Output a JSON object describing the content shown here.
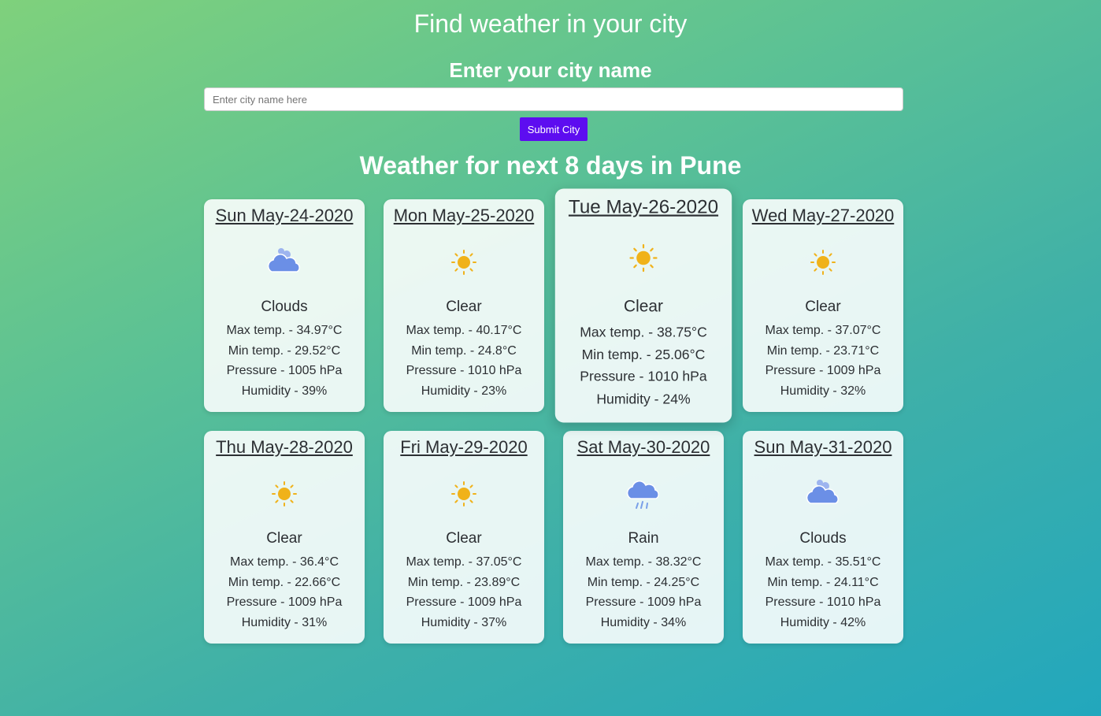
{
  "header": {
    "title": "Find weather in your city",
    "city_label": "Enter your city name",
    "input_placeholder": "Enter city name here",
    "input_value": "",
    "submit_label": "Submit City"
  },
  "forecast": {
    "title": "Weather for next 8 days in Pune",
    "days": [
      {
        "date": "Sun May-24-2020",
        "icon": "clouds-icon",
        "desc": "Clouds",
        "max": "Max temp. - 34.97°C",
        "min": "Min temp. - 29.52°C",
        "pressure": "Pressure - 1005 hPa",
        "humidity": "Humidity - 39%"
      },
      {
        "date": "Mon May-25-2020",
        "icon": "sun-icon",
        "desc": "Clear",
        "max": "Max temp. - 40.17°C",
        "min": "Min temp. - 24.8°C",
        "pressure": "Pressure - 1010 hPa",
        "humidity": "Humidity - 23%"
      },
      {
        "date": "Tue May-26-2020",
        "icon": "sun-icon",
        "desc": "Clear",
        "max": "Max temp. - 38.75°C",
        "min": "Min temp. - 25.06°C",
        "pressure": "Pressure - 1010 hPa",
        "humidity": "Humidity - 24%"
      },
      {
        "date": "Wed May-27-2020",
        "icon": "sun-icon",
        "desc": "Clear",
        "max": "Max temp. - 37.07°C",
        "min": "Min temp. - 23.71°C",
        "pressure": "Pressure - 1009 hPa",
        "humidity": "Humidity - 32%"
      },
      {
        "date": "Thu May-28-2020",
        "icon": "sun-icon",
        "desc": "Clear",
        "max": "Max temp. - 36.4°C",
        "min": "Min temp. - 22.66°C",
        "pressure": "Pressure - 1009 hPa",
        "humidity": "Humidity - 31%"
      },
      {
        "date": "Fri May-29-2020",
        "icon": "sun-icon",
        "desc": "Clear",
        "max": "Max temp. - 37.05°C",
        "min": "Min temp. - 23.89°C",
        "pressure": "Pressure - 1009 hPa",
        "humidity": "Humidity - 37%"
      },
      {
        "date": "Sat May-30-2020",
        "icon": "rain-icon",
        "desc": "Rain",
        "max": "Max temp. - 38.32°C",
        "min": "Min temp. - 24.25°C",
        "pressure": "Pressure - 1009 hPa",
        "humidity": "Humidity - 34%"
      },
      {
        "date": "Sun May-31-2020",
        "icon": "clouds-icon",
        "desc": "Clouds",
        "max": "Max temp. - 35.51°C",
        "min": "Min temp. - 24.11°C",
        "pressure": "Pressure - 1010 hPa",
        "humidity": "Humidity - 42%"
      }
    ]
  },
  "colors": {
    "submit_button": "#5d0df0",
    "sun": "#f0b21a",
    "cloud": "#6b8fe6",
    "rain": "#7aa0e8"
  }
}
